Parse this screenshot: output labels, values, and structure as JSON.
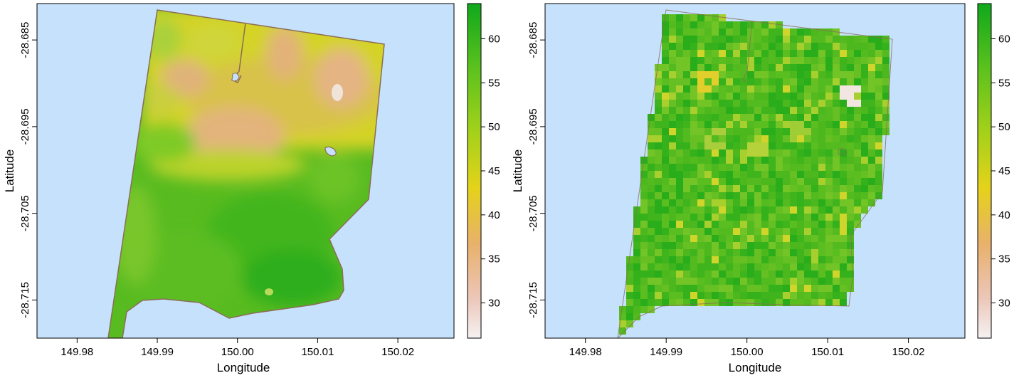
{
  "chart_data": [
    {
      "type": "heatmap",
      "title": "",
      "xlabel": "Longitude",
      "ylabel": "Latitude",
      "xlim": [
        149.975,
        150.027
      ],
      "ylim": [
        -28.7194,
        -28.6808
      ],
      "x_ticks": [
        "149.98",
        "149.99",
        "150.00",
        "150.01",
        "150.02"
      ],
      "y_ticks": [
        "-28.685",
        "-28.695",
        "-28.705",
        "-28.715"
      ],
      "colorbar": {
        "min": 26,
        "max": 64,
        "ticks": [
          "30",
          "35",
          "40",
          "45",
          "50",
          "55",
          "60"
        ]
      },
      "background_color": "#c6e1fb",
      "style": "smooth"
    },
    {
      "type": "heatmap",
      "title": "",
      "xlabel": "Longitude",
      "ylabel": "Latitude",
      "xlim": [
        149.975,
        150.027
      ],
      "ylim": [
        -28.7194,
        -28.6808
      ],
      "x_ticks": [
        "149.98",
        "149.99",
        "150.00",
        "150.01",
        "150.02"
      ],
      "y_ticks": [
        "-28.685",
        "-28.695",
        "-28.705",
        "-28.715"
      ],
      "colorbar": {
        "min": 26,
        "max": 64,
        "ticks": [
          "30",
          "35",
          "40",
          "45",
          "50",
          "55",
          "60"
        ]
      },
      "background_color": "#c6e1fb",
      "style": "pixelated"
    }
  ]
}
